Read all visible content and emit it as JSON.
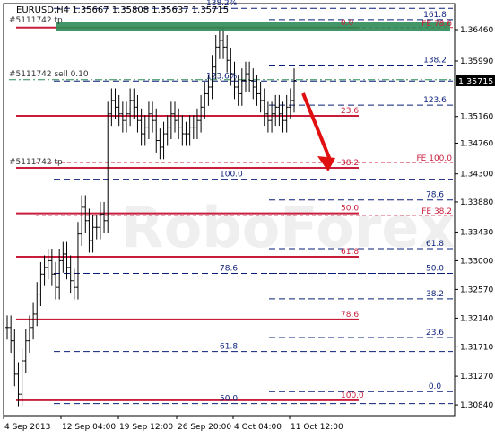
{
  "chart_data": {
    "type": "candlestick",
    "header": "EURUSD,H4  1.35667 1.35808 1.35637 1.35715",
    "watermark": "RoboForex",
    "price_axis": {
      "min": 1.3068,
      "max": 1.3685,
      "ticks": [
        "1.36460",
        "1.35990",
        "1.35160",
        "1.34760",
        "1.34300",
        "1.33880",
        "1.33430",
        "1.33000",
        "1.32570",
        "1.32140",
        "1.31710",
        "1.31270",
        "1.30840"
      ],
      "current_price": "1.35715"
    },
    "time_axis": {
      "labels": [
        "4 Sep 2013",
        "12 Sep 04:00",
        "19 Sep 12:00",
        "26 Sep 20:00",
        "4 Oct 04:00",
        "11 Oct 12:00"
      ]
    },
    "trade_labels": [
      "#5111742 tp",
      "#5111742 sell 0.10",
      "#5111742 tp"
    ],
    "fib_levels_red": [
      {
        "label": "0.0",
        "price": 1.3649
      },
      {
        "label": "23.6",
        "price": 1.3517
      },
      {
        "label": "38.2",
        "price": 1.3439
      },
      {
        "label": "50.0",
        "price": 1.3371
      },
      {
        "label": "61.8",
        "price": 1.3306
      },
      {
        "label": "78.6",
        "price": 1.3212
      },
      {
        "label": "100.0",
        "price": 1.3091
      }
    ],
    "fib_levels_navy_right": [
      {
        "label": "161.8",
        "price": 1.3661
      },
      {
        "label": "138.2",
        "price": 1.3593
      },
      {
        "label": "123.6",
        "price": 1.3533
      },
      {
        "label": "78.6",
        "price": 1.3391
      },
      {
        "label": "61.8",
        "price": 1.3318
      },
      {
        "label": "50.0",
        "price": 1.3281
      },
      {
        "label": "38.2",
        "price": 1.3243
      },
      {
        "label": "23.6",
        "price": 1.3185
      },
      {
        "label": "0.0",
        "price": 1.3104
      }
    ],
    "fib_levels_navy_left": [
      {
        "label": "138.2%",
        "price": 1.3678
      },
      {
        "label": "123.6%",
        "price": 1.3569
      },
      {
        "label": "100.0",
        "price": 1.3422
      },
      {
        "label": "78.6",
        "price": 1.3281
      },
      {
        "label": "61.8",
        "price": 1.3164
      },
      {
        "label": "50.0",
        "price": 1.3086
      }
    ],
    "fe_labels": [
      {
        "label": "FE 78.6",
        "price": 1.3649
      },
      {
        "label": "FE 100.0",
        "price": 1.3447
      },
      {
        "label": "FE 38.2",
        "price": 1.3368
      }
    ],
    "close_series": [
      1.32,
      1.318,
      1.313,
      1.31,
      1.315,
      1.318,
      1.32,
      1.322,
      1.325,
      1.328,
      1.329,
      1.33,
      1.328,
      1.326,
      1.33,
      1.331,
      1.329,
      1.327,
      1.326,
      1.334,
      1.338,
      1.336,
      1.333,
      1.335,
      1.335,
      1.337,
      1.336,
      1.352,
      1.354,
      1.353,
      1.352,
      1.351,
      1.352,
      1.354,
      1.353,
      1.351,
      1.349,
      1.35,
      1.352,
      1.351,
      1.348,
      1.347,
      1.349,
      1.35,
      1.352,
      1.351,
      1.35,
      1.349,
      1.349,
      1.35,
      1.35,
      1.351,
      1.353,
      1.355,
      1.356,
      1.359,
      1.362,
      1.363,
      1.362,
      1.36,
      1.358,
      1.356,
      1.355,
      1.357,
      1.358,
      1.357,
      1.356,
      1.355,
      1.354,
      1.352,
      1.351,
      1.352,
      1.353,
      1.352,
      1.351,
      1.353,
      1.354,
      1.357
    ]
  }
}
